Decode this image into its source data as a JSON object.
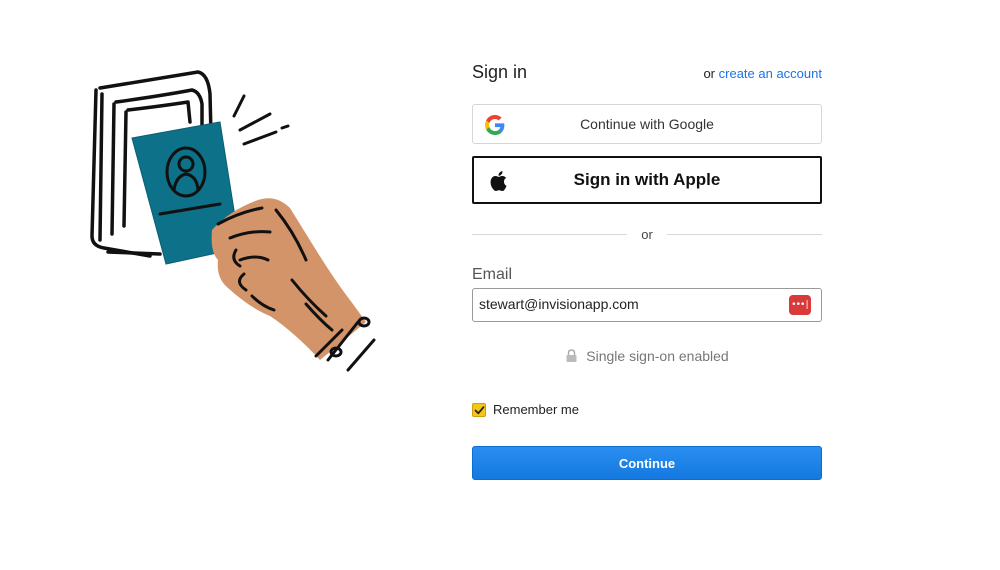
{
  "header": {
    "title": "Sign in",
    "or_text": "or",
    "create_link": "create an account"
  },
  "buttons": {
    "google_label": "Continue with Google",
    "apple_label": "Sign in with Apple",
    "continue_label": "Continue"
  },
  "divider": {
    "text": "or"
  },
  "email": {
    "label": "Email",
    "value": "stewart@invisionapp.com"
  },
  "sso": {
    "text": "Single sign-on enabled"
  },
  "remember": {
    "label": "Remember me",
    "checked": true
  },
  "colors": {
    "link": "#1a73e8",
    "primary": "#1479e0",
    "card_teal": "#0d7189",
    "skin": "#d4946a",
    "checkbox": "#f5c518",
    "password_manager": "#d93a3a"
  },
  "icons": {
    "google": "google-icon",
    "apple": "apple-icon",
    "lock": "lock-icon",
    "password_manager": "password-manager-icon"
  }
}
